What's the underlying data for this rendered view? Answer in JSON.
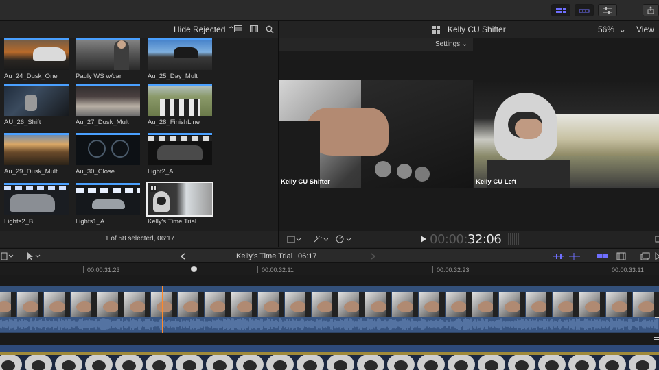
{
  "browser": {
    "filter_label": "Hide Rejected",
    "clips": [
      {
        "name": "Au_24_Dusk_One"
      },
      {
        "name": "Pauly WS w/car"
      },
      {
        "name": "Au_25_Day_Mult"
      },
      {
        "name": "AU_26_Shift"
      },
      {
        "name": "Au_27_Dusk_Mult"
      },
      {
        "name": "Au_28_FinishLine"
      },
      {
        "name": "Au_29_Dusk_Mult"
      },
      {
        "name": "Au_30_Close"
      },
      {
        "name": "Light2_A"
      },
      {
        "name": "Lights2_B"
      },
      {
        "name": "Lights1_A"
      },
      {
        "name": "Kelly's Time Trial"
      }
    ],
    "status": "1 of 58 selected, 06:17"
  },
  "viewer": {
    "title": "Kelly CU Shifter",
    "zoom": "56%",
    "view_label": "View",
    "settings_label": "Settings",
    "angles": [
      {
        "label": "Kelly CU Shifter"
      },
      {
        "label": "Kelly CU Left"
      }
    ],
    "timecode_dim": "00:00:",
    "timecode_bright": "32:06"
  },
  "timeline": {
    "project_title": "Kelly's Time Trial",
    "duration": "06:17",
    "ruler_labels": [
      "00:00:31:23",
      "00:00:32:11",
      "00:00:32:23",
      "00:00:33:11"
    ]
  },
  "colors": {
    "accent": "#4aa0ff",
    "clip_blue": "#2e4466",
    "audio_blue": "#3a5784",
    "skimmer": "#ff8a2a"
  }
}
